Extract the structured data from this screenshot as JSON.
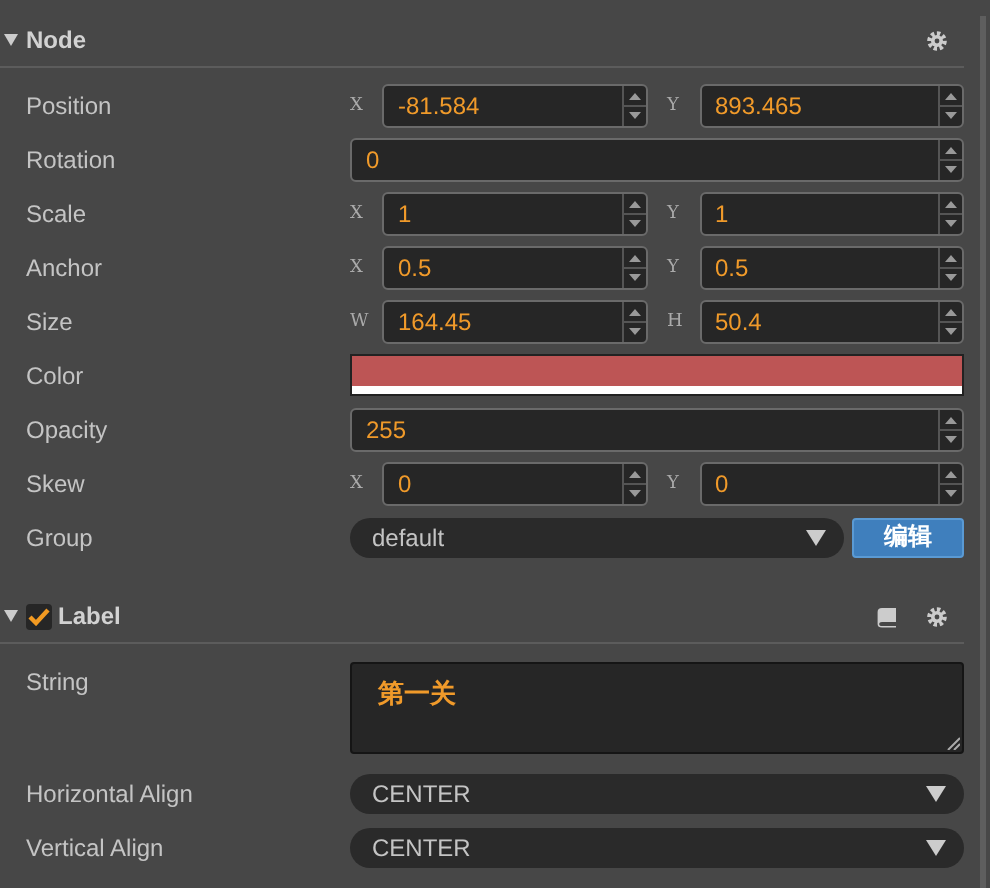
{
  "sections": [
    {
      "title": "Node",
      "expanded": true,
      "properties": [
        {
          "label": "Position",
          "kind": "vector",
          "fields": [
            {
              "axis": "X",
              "value": "-81.584"
            },
            {
              "axis": "Y",
              "value": "893.465"
            }
          ]
        },
        {
          "label": "Rotation",
          "kind": "number",
          "value": "0"
        },
        {
          "label": "Scale",
          "kind": "vector",
          "fields": [
            {
              "axis": "X",
              "value": "1"
            },
            {
              "axis": "Y",
              "value": "1"
            }
          ]
        },
        {
          "label": "Anchor",
          "kind": "vector",
          "fields": [
            {
              "axis": "X",
              "value": "0.5"
            },
            {
              "axis": "Y",
              "value": "0.5"
            }
          ]
        },
        {
          "label": "Size",
          "kind": "vector",
          "fields": [
            {
              "axis": "W",
              "value": "164.45"
            },
            {
              "axis": "H",
              "value": "50.4"
            }
          ]
        },
        {
          "label": "Color",
          "kind": "color",
          "color": "#bd5555",
          "level": 1
        },
        {
          "label": "Opacity",
          "kind": "number",
          "value": "255"
        },
        {
          "label": "Skew",
          "kind": "vector",
          "fields": [
            {
              "axis": "X",
              "value": "0"
            },
            {
              "axis": "Y",
              "value": "0"
            }
          ]
        },
        {
          "label": "Group",
          "kind": "select",
          "value": "default",
          "button": "编辑"
        }
      ]
    },
    {
      "title": "Label",
      "expanded": true,
      "checked": true,
      "properties": [
        {
          "label": "String",
          "kind": "textarea",
          "value": "第一关"
        },
        {
          "label": "Horizontal Align",
          "kind": "select",
          "value": "CENTER"
        },
        {
          "label": "Vertical Align",
          "kind": "select",
          "value": "CENTER"
        }
      ]
    }
  ]
}
